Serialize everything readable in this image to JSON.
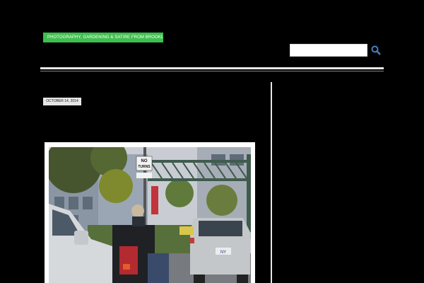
{
  "header": {
    "tagline": "PHOTOGRAPHY, GARDENING & SATIRE FROM BROOKLYN"
  },
  "search": {
    "placeholder": "",
    "icon": "search-icon"
  },
  "post": {
    "date": "OCTOBER 14, 2014",
    "category": "",
    "comments": "",
    "title": ""
  },
  "photo": {
    "sign_line1": "NO",
    "sign_line2": "TURNS",
    "plate": "NY"
  }
}
